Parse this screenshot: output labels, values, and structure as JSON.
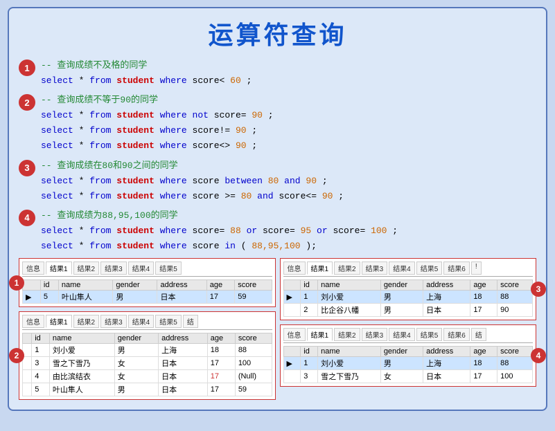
{
  "title": "运算符查询",
  "sections": [
    {
      "id": "1",
      "comment": "-- 查询成绩不及格的同学",
      "lines": [
        {
          "parts": [
            {
              "t": "select",
              "c": "kw"
            },
            {
              "t": " * ",
              "c": "plain"
            },
            {
              "t": "from",
              "c": "kw"
            },
            {
              "t": " ",
              "c": "plain"
            },
            {
              "t": "student",
              "c": "tbl"
            },
            {
              "t": " ",
              "c": "plain"
            },
            {
              "t": "where",
              "c": "kw"
            },
            {
              "t": " score",
              "c": "plain"
            },
            {
              "t": "<60;",
              "c": "val"
            }
          ]
        }
      ]
    },
    {
      "id": "2",
      "comment": "-- 查询成绩不等于90的同学",
      "lines": [
        {
          "parts": [
            {
              "t": "select",
              "c": "kw"
            },
            {
              "t": " * ",
              "c": "plain"
            },
            {
              "t": "from",
              "c": "kw"
            },
            {
              "t": " ",
              "c": "plain"
            },
            {
              "t": "student",
              "c": "tbl"
            },
            {
              "t": " ",
              "c": "plain"
            },
            {
              "t": "where",
              "c": "kw"
            },
            {
              "t": " ",
              "c": "plain"
            },
            {
              "t": "not",
              "c": "kw"
            },
            {
              "t": " score=",
              "c": "plain"
            },
            {
              "t": "90",
              "c": "val"
            },
            {
              "t": ";",
              "c": "plain"
            }
          ]
        },
        {
          "parts": [
            {
              "t": "select",
              "c": "kw"
            },
            {
              "t": " * ",
              "c": "plain"
            },
            {
              "t": "from",
              "c": "kw"
            },
            {
              "t": " ",
              "c": "plain"
            },
            {
              "t": "student",
              "c": "tbl"
            },
            {
              "t": " ",
              "c": "plain"
            },
            {
              "t": "where",
              "c": "kw"
            },
            {
              "t": " score!=",
              "c": "plain"
            },
            {
              "t": "90",
              "c": "val"
            },
            {
              "t": ";",
              "c": "plain"
            }
          ]
        },
        {
          "parts": [
            {
              "t": "select",
              "c": "kw"
            },
            {
              "t": " * ",
              "c": "plain"
            },
            {
              "t": "from",
              "c": "kw"
            },
            {
              "t": " ",
              "c": "plain"
            },
            {
              "t": "student",
              "c": "tbl"
            },
            {
              "t": " ",
              "c": "plain"
            },
            {
              "t": "where",
              "c": "kw"
            },
            {
              "t": " score<>",
              "c": "plain"
            },
            {
              "t": "90",
              "c": "val"
            },
            {
              "t": ";",
              "c": "plain"
            }
          ]
        }
      ]
    },
    {
      "id": "3",
      "comment": "-- 查询成绩在80和90之间的同学",
      "lines": [
        {
          "parts": [
            {
              "t": "select",
              "c": "kw"
            },
            {
              "t": " * ",
              "c": "plain"
            },
            {
              "t": "from",
              "c": "kw"
            },
            {
              "t": " ",
              "c": "plain"
            },
            {
              "t": "student",
              "c": "tbl"
            },
            {
              "t": " ",
              "c": "plain"
            },
            {
              "t": "where",
              "c": "kw"
            },
            {
              "t": " score ",
              "c": "plain"
            },
            {
              "t": "between",
              "c": "kw"
            },
            {
              "t": " ",
              "c": "plain"
            },
            {
              "t": "80",
              "c": "val"
            },
            {
              "t": " ",
              "c": "plain"
            },
            {
              "t": "and",
              "c": "kw"
            },
            {
              "t": " ",
              "c": "plain"
            },
            {
              "t": "90",
              "c": "val"
            },
            {
              "t": ";",
              "c": "plain"
            }
          ]
        },
        {
          "parts": [
            {
              "t": "select",
              "c": "kw"
            },
            {
              "t": " * ",
              "c": "plain"
            },
            {
              "t": "from",
              "c": "kw"
            },
            {
              "t": " ",
              "c": "plain"
            },
            {
              "t": "student",
              "c": "tbl"
            },
            {
              "t": " ",
              "c": "plain"
            },
            {
              "t": "where",
              "c": "kw"
            },
            {
              "t": " score >=",
              "c": "plain"
            },
            {
              "t": "80",
              "c": "val"
            },
            {
              "t": " ",
              "c": "plain"
            },
            {
              "t": "and",
              "c": "kw"
            },
            {
              "t": " score<=",
              "c": "plain"
            },
            {
              "t": "90",
              "c": "val"
            },
            {
              "t": ";",
              "c": "plain"
            }
          ]
        }
      ]
    },
    {
      "id": "4",
      "comment": "-- 查询成绩为88,95,100的同学",
      "lines": [
        {
          "parts": [
            {
              "t": "select",
              "c": "kw"
            },
            {
              "t": " * ",
              "c": "plain"
            },
            {
              "t": "from",
              "c": "kw"
            },
            {
              "t": " ",
              "c": "plain"
            },
            {
              "t": "student",
              "c": "tbl"
            },
            {
              "t": " ",
              "c": "plain"
            },
            {
              "t": "where",
              "c": "kw"
            },
            {
              "t": " score=",
              "c": "plain"
            },
            {
              "t": "88",
              "c": "val"
            },
            {
              "t": " ",
              "c": "plain"
            },
            {
              "t": "or",
              "c": "kw"
            },
            {
              "t": " score=",
              "c": "plain"
            },
            {
              "t": "95",
              "c": "val"
            },
            {
              "t": " ",
              "c": "plain"
            },
            {
              "t": "or",
              "c": "kw"
            },
            {
              "t": " score=",
              "c": "plain"
            },
            {
              "t": "100",
              "c": "val"
            },
            {
              "t": ";",
              "c": "plain"
            }
          ]
        },
        {
          "parts": [
            {
              "t": "select",
              "c": "kw"
            },
            {
              "t": " * ",
              "c": "plain"
            },
            {
              "t": "from",
              "c": "kw"
            },
            {
              "t": " ",
              "c": "plain"
            },
            {
              "t": "student",
              "c": "tbl"
            },
            {
              "t": " ",
              "c": "plain"
            },
            {
              "t": "where",
              "c": "kw"
            },
            {
              "t": " score ",
              "c": "plain"
            },
            {
              "t": "in",
              "c": "kw"
            },
            {
              "t": "(",
              "c": "plain"
            },
            {
              "t": "88,95,100",
              "c": "val"
            },
            {
              "t": ");",
              "c": "plain"
            }
          ]
        }
      ]
    }
  ],
  "tables": {
    "panel1": {
      "tabs": [
        "信息",
        "结果1",
        "结果2",
        "结果3",
        "结果4",
        "结果5"
      ],
      "active": 1,
      "columns": [
        "",
        "id",
        "name",
        "gender",
        "address",
        "age",
        "score"
      ],
      "rows": [
        {
          "marker": "▶",
          "selected": true,
          "id": "5",
          "name": "叶山隼人",
          "gender": "男",
          "address": "日本",
          "age": "17",
          "score": "59"
        }
      ]
    },
    "panel2": {
      "tabs": [
        "信息",
        "结果1",
        "结果2",
        "结果3",
        "结果4",
        "结果5",
        "结果n"
      ],
      "active": 1,
      "columns": [
        "",
        "id",
        "name",
        "gender",
        "address",
        "age",
        "score"
      ],
      "rows": [
        {
          "marker": "",
          "selected": false,
          "id": "1",
          "name": "刘小爱",
          "gender": "男",
          "address": "上海",
          "age": "18",
          "score": "88"
        },
        {
          "marker": "",
          "selected": false,
          "id": "3",
          "name": "雪之下雪乃",
          "gender": "女",
          "address": "日本",
          "age": "17",
          "score": "100"
        },
        {
          "marker": "",
          "selected": false,
          "id": "4",
          "name": "由比滨结衣",
          "gender": "女",
          "address": "日本",
          "age": "17",
          "score": "(Null)"
        },
        {
          "marker": "",
          "selected": false,
          "id": "5",
          "name": "叶山隼人",
          "gender": "男",
          "address": "日本",
          "age": "17",
          "score": "59"
        }
      ]
    },
    "panel3": {
      "tabs": [
        "信息",
        "结果1",
        "结果2",
        "结果3",
        "结果4",
        "结果5",
        "结果6",
        "结果n"
      ],
      "active": 1,
      "columns": [
        "",
        "id",
        "name",
        "gender",
        "address",
        "age",
        "score"
      ],
      "rows": [
        {
          "marker": "▶",
          "selected": true,
          "id": "1",
          "name": "刘小爱",
          "gender": "男",
          "address": "上海",
          "age": "18",
          "score": "88"
        },
        {
          "marker": "",
          "selected": false,
          "id": "2",
          "name": "比企谷八幡",
          "gender": "男",
          "address": "日本",
          "age": "17",
          "score": "90"
        }
      ]
    },
    "panel4": {
      "tabs": [
        "信息",
        "结果1",
        "结果2",
        "结果3",
        "结果4",
        "结果5",
        "结果6",
        "结果n"
      ],
      "active": 1,
      "columns": [
        "",
        "id",
        "name",
        "gender",
        "address",
        "age",
        "score"
      ],
      "rows": [
        {
          "marker": "▶",
          "selected": true,
          "id": "1",
          "name": "刘小爱",
          "gender": "男",
          "address": "上海",
          "age": "18",
          "score": "88"
        },
        {
          "marker": "",
          "selected": false,
          "id": "3",
          "name": "雪之下雪乃",
          "gender": "女",
          "address": "日本",
          "age": "17",
          "score": "100"
        }
      ]
    }
  },
  "badge_labels": [
    "1",
    "2",
    "3",
    "4"
  ],
  "colors": {
    "badge_bg": "#cc3333",
    "title": "#1155cc",
    "comment": "#228833",
    "keyword": "#0000cc",
    "table": "#cc0000",
    "value": "#cc6600"
  }
}
